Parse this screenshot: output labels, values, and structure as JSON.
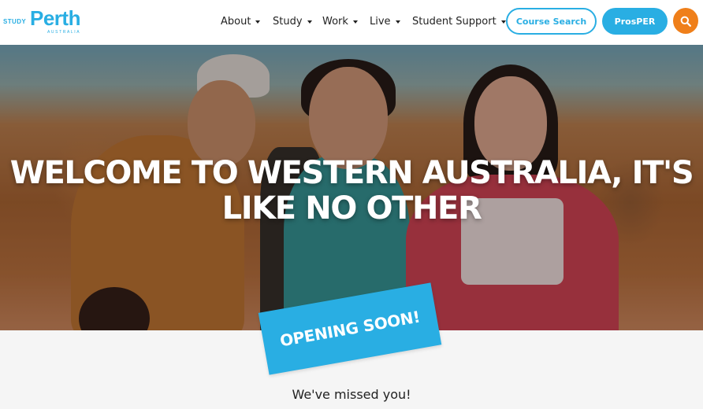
{
  "logo": {
    "study": "STUDY",
    "perth": "Perth",
    "australia": "AUSTRALIA"
  },
  "nav": {
    "items": [
      {
        "label": "About"
      },
      {
        "label": "Study"
      },
      {
        "label": "Work"
      },
      {
        "label": "Live"
      },
      {
        "label": "Student Support"
      }
    ]
  },
  "buttons": {
    "course_search": "Course Search",
    "prosper": "ProsPER",
    "search_icon": "search-icon"
  },
  "hero": {
    "title_line1": "WELCOME TO WESTERN AUSTRALIA, IT'S",
    "title_line2": "LIKE NO OTHER",
    "photo": "photo of three smiling students in a desert landscape"
  },
  "badge": {
    "label": "OPENING SOON!"
  },
  "content": {
    "missed": "We've missed you!"
  },
  "colors": {
    "brand_blue": "#29aee3",
    "accent_orange": "#ef7f1a"
  }
}
